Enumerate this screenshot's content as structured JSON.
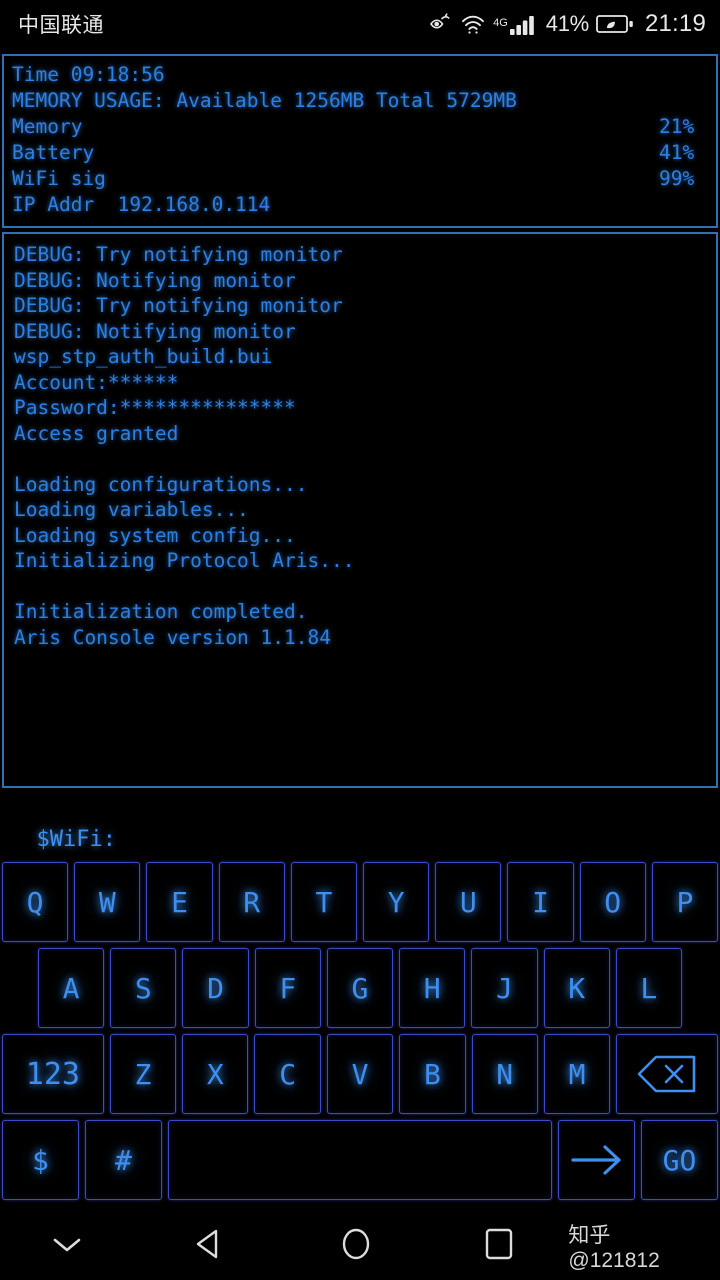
{
  "status_bar": {
    "carrier": "中国联通",
    "icons": [
      "eye-comfort-icon",
      "wifi-icon",
      "signal-4g-icon",
      "battery-saver-icon"
    ],
    "network_label": "4G",
    "battery_percent": "41%",
    "clock": "21:19"
  },
  "info_panel": {
    "time_line": "Time 09:18:56",
    "memory_line": "MEMORY USAGE: Available 1256MB Total 5729MB",
    "meters": [
      {
        "label": "Memory",
        "percent": 21,
        "percent_text": "21%"
      },
      {
        "label": "Battery",
        "percent": 41,
        "percent_text": "41%"
      },
      {
        "label": "WiFi sig",
        "percent": 99,
        "percent_text": "99%"
      }
    ],
    "ip_label": "IP Addr",
    "ip_value": "192.168.0.114",
    "ip_line": "IP Addr  192.168.0.114"
  },
  "console": {
    "lines": [
      "DEBUG: Try notifying monitor",
      "DEBUG: Notifying monitor",
      "DEBUG: Try notifying monitor",
      "DEBUG: Notifying monitor",
      "wsp_stp_auth_build.bui",
      "Account:******",
      "Password:***************",
      "Access granted",
      "",
      "Loading configurations...",
      "Loading variables...",
      "Loading system config...",
      "Initializing Protocol Aris...",
      "",
      "Initialization completed.",
      "Aris Console version 1.1.84"
    ]
  },
  "prompt": {
    "text": "$WiFi:",
    "value": ""
  },
  "keyboard": {
    "row1": [
      "Q",
      "W",
      "E",
      "R",
      "T",
      "Y",
      "U",
      "I",
      "O",
      "P"
    ],
    "row2": [
      "A",
      "S",
      "D",
      "F",
      "G",
      "H",
      "J",
      "K",
      "L"
    ],
    "row3_num": "123",
    "row3": [
      "Z",
      "X",
      "C",
      "V",
      "B",
      "N",
      "M"
    ],
    "row3_backspace": "backspace-icon",
    "row4": {
      "dollar": "$",
      "hash": "#",
      "space": "",
      "arrow": "→",
      "go": "GO"
    }
  },
  "nav_bar": {
    "hide_keyboard": "chevron-down-icon",
    "back": "back-triangle-icon",
    "home": "home-circle-icon",
    "recents": "recents-square-icon",
    "watermark": "知乎 @121812"
  },
  "colors": {
    "accent_blue": "#2e7fe0",
    "bar_blue": "#2481ce",
    "panel_border": "#2f6fb8",
    "key_border": "#3b4bc8",
    "background": "#000000"
  }
}
